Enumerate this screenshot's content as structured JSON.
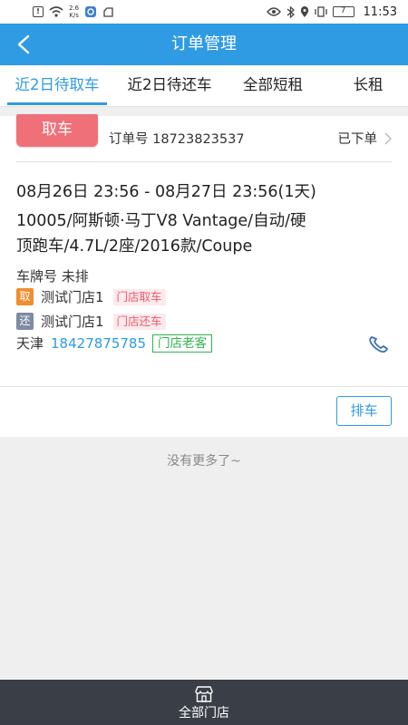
{
  "status_bar": {
    "network_speed_top": "2.6",
    "network_speed_bottom": "K/s",
    "battery": "7",
    "time": "11:53"
  },
  "nav": {
    "title": "订单管理",
    "back_icon": "chevron-left-icon"
  },
  "tabs": [
    {
      "label": "近2日待取车",
      "active": true
    },
    {
      "label": "近2日待还车",
      "active": false
    },
    {
      "label": "全部短租",
      "active": false
    },
    {
      "label": "长租",
      "active": false
    }
  ],
  "order": {
    "type_badge": "取车",
    "order_no_label": "订单号",
    "order_no": "18723823537",
    "status": "已下单",
    "date_range": "08月26日 23:56 - 08月27日 23:56(1天)",
    "car_line1": "10005/阿斯顿·马丁V8 Vantage/自动/硬",
    "car_line2": "顶跑车/4.7L/2座/2016款/Coupe",
    "plate_label": "车牌号",
    "plate_value": "未排",
    "pickup_mark": "取",
    "pickup_store": "测试门店1",
    "pickup_tag": "门店取车",
    "return_mark": "还",
    "return_store": "测试门店1",
    "return_tag": "门店还车",
    "city": "天津",
    "phone": "18427875785",
    "customer_tag": "门店老客",
    "dispatch_button": "排车"
  },
  "list_end_text": "没有更多了~",
  "bottom_bar": {
    "label": "全部门店",
    "icon": "store-icon"
  },
  "colors": {
    "primary": "#2f9be3",
    "ribbon": "#f0707a",
    "pickup_mark": "#f08d2e",
    "return_mark": "#7f8aa4",
    "pink_tag": "#ee5a6b",
    "green_tag": "#2fb44e",
    "bottom_bar": "#3a3f47"
  }
}
